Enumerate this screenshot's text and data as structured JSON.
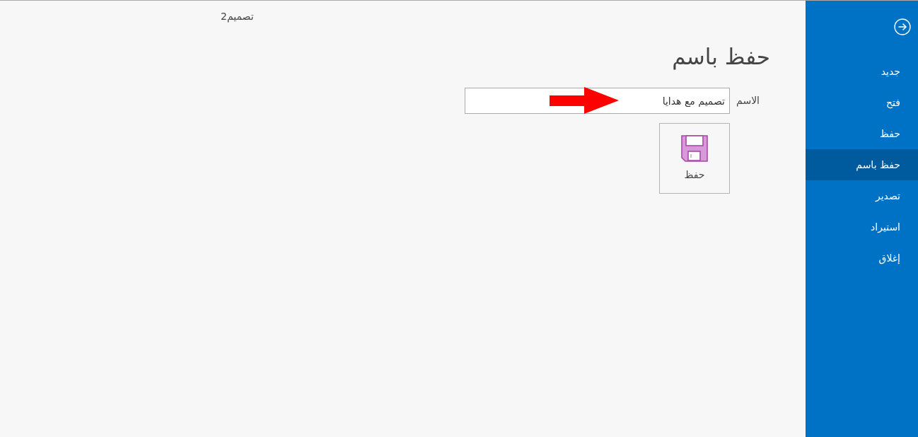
{
  "window": {
    "title": "تصميم2"
  },
  "sidebar": {
    "items": [
      {
        "label": "جديد",
        "selected": false
      },
      {
        "label": "فتح",
        "selected": false
      },
      {
        "label": "حفظ",
        "selected": false
      },
      {
        "label": "حفظ باسم",
        "selected": true
      },
      {
        "label": "تصدير",
        "selected": false
      },
      {
        "label": "استيراد",
        "selected": false
      },
      {
        "label": "إغلاق",
        "selected": false
      }
    ]
  },
  "page": {
    "heading": "حفظ باسم",
    "name_field": {
      "label": "الاسم",
      "value": "تصميم مع هدايا"
    },
    "save_button": {
      "label": "حفظ"
    }
  }
}
